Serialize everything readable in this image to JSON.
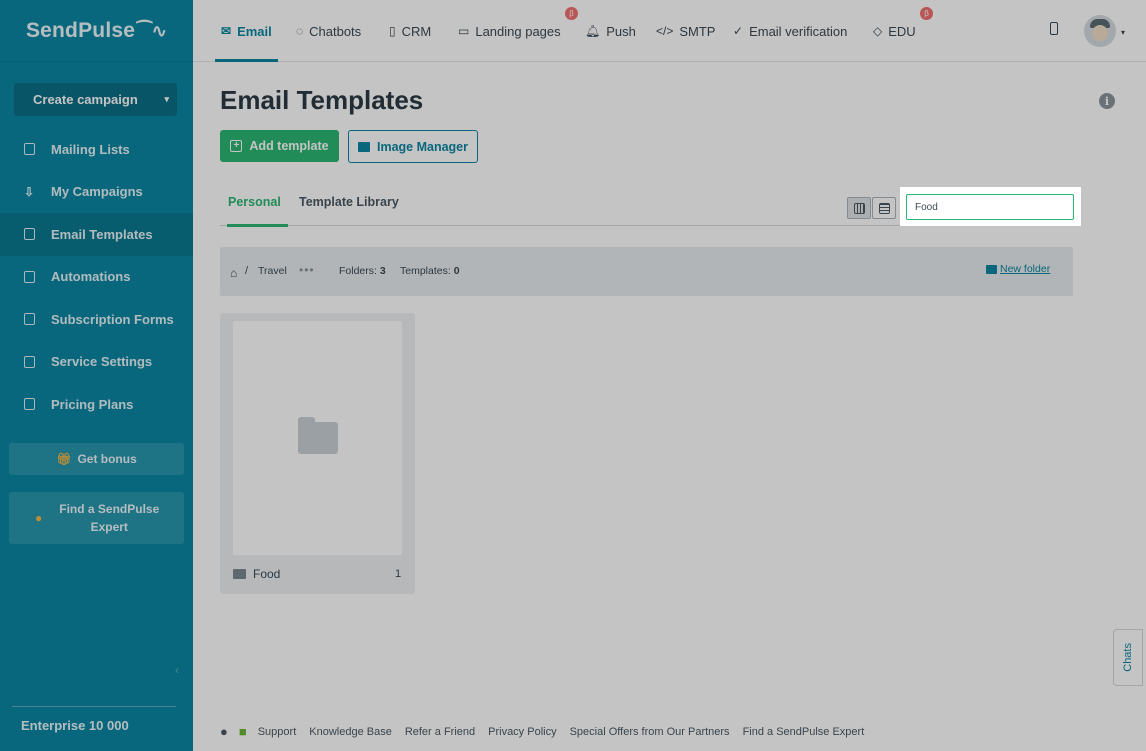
{
  "brand": {
    "logo": "SendPulse",
    "logo_mark": "⁀∿"
  },
  "sidebar": {
    "create_campaign": "Create campaign",
    "items": [
      {
        "label": "Mailing Lists",
        "icon": "list-book-icon"
      },
      {
        "label": "My Campaigns",
        "icon": "campaign-tray-icon"
      },
      {
        "label": "Email Templates",
        "icon": "template-icon",
        "active": true
      },
      {
        "label": "Automations",
        "icon": "automation-icon"
      },
      {
        "label": "Subscription Forms",
        "icon": "form-icon"
      },
      {
        "label": "Service Settings",
        "icon": "settings-grid-icon"
      },
      {
        "label": "Pricing Plans",
        "icon": "wallet-icon"
      }
    ],
    "get_bonus": "Get bonus",
    "find_expert": "Find a SendPulse Expert",
    "plan": "Enterprise 10 000"
  },
  "topnav": {
    "tabs": [
      {
        "label": "Email",
        "icon": "envelope-icon",
        "active": true
      },
      {
        "label": "Chatbots",
        "icon": "chat-bubble-icon"
      },
      {
        "label": "CRM",
        "icon": "crm-icon"
      },
      {
        "label": "Landing pages",
        "icon": "landing-page-icon",
        "badge": "β"
      },
      {
        "label": "Push",
        "icon": "bell-icon"
      },
      {
        "label": "SMTP",
        "icon": "code-icon"
      },
      {
        "label": "Email verification",
        "icon": "check-circle-icon"
      },
      {
        "label": "EDU",
        "icon": "graduation-cap-icon",
        "badge": "β"
      }
    ]
  },
  "main": {
    "title": "Email Templates",
    "add_template": "Add template",
    "image_manager": "Image Manager",
    "subtabs": [
      "Personal",
      "Template Library"
    ],
    "search": {
      "value": "Food",
      "placeholder": ""
    },
    "breadcrumb": {
      "separator": "/",
      "current": "Travel",
      "folders_label": "Folders:",
      "folders_count": "3",
      "templates_label": "Templates:",
      "templates_count": "0",
      "new_folder": "New folder"
    },
    "folder": {
      "name": "Food",
      "count": "1"
    }
  },
  "footer": {
    "links": [
      "Support",
      "Knowledge Base",
      "Refer a Friend",
      "Privacy Policy",
      "Special Offers from Our Partners",
      "Find a SendPulse Expert"
    ]
  },
  "chats": "Chats",
  "colors": {
    "sidebar": "#0b86a2",
    "accent_green": "#2bb673",
    "accent_teal": "#0b86a2",
    "beta": "#f26f6f"
  }
}
